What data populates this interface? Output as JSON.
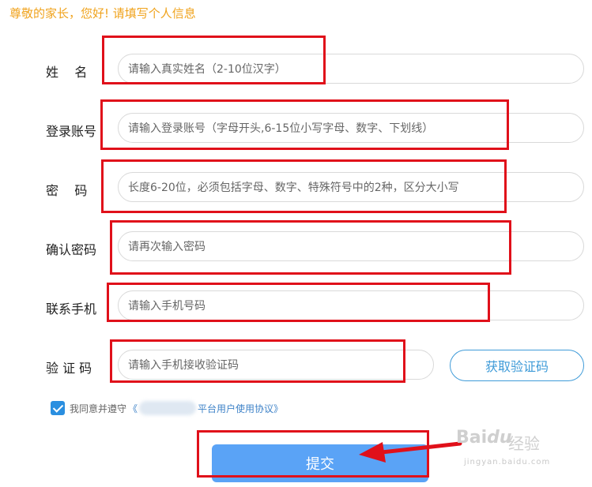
{
  "greeting": "尊敬的家长，您好! 请填写个人信息",
  "form": {
    "name": {
      "label": "姓    名",
      "placeholder": "请输入真实姓名（2-10位汉字）"
    },
    "account": {
      "label": "登录账号",
      "placeholder": "请输入登录账号（字母开头,6-15位小写字母、数字、下划线）"
    },
    "password": {
      "label": "密    码",
      "placeholder": "长度6-20位，必须包括字母、数字、特殊符号中的2种，区分大小写"
    },
    "confirm": {
      "label": "确认密码",
      "placeholder": "请再次输入密码"
    },
    "phone": {
      "label": "联系手机",
      "placeholder": "请输入手机号码"
    },
    "code": {
      "label": "验 证 码",
      "placeholder": "请输入手机接收验证码",
      "button": "获取验证码"
    }
  },
  "agreement": {
    "checked": true,
    "prefix": "我同意并遵守",
    "link_open": "《",
    "link_rest": "平台用户使用协议》"
  },
  "submit_label": "提交",
  "watermark": {
    "logo": "Bai",
    "logo2": "du",
    "text": "经验",
    "sub": "jingyan.baidu.com"
  },
  "colors": {
    "accent": "#3f9bd8",
    "greeting": "#f0a31d",
    "annotation": "#e0101a",
    "submit": "#5aa3f6"
  }
}
